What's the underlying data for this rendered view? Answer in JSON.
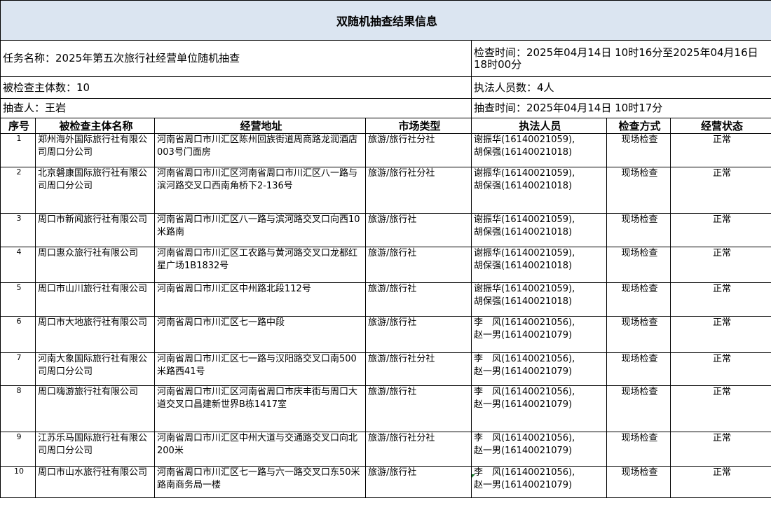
{
  "title": "双随机抽查结果信息",
  "info": {
    "task": "任务名称：2025年第五次旅行社经营单位随机抽查",
    "inspect_time": "检查时间：2025年04月14日 10时16分至2025年04月16日 18时00分",
    "subject_count": "被检查主体数：10",
    "officer_count": "执法人员数：4人",
    "sampler": "抽查人：王岩",
    "sample_time": "抽查时间：2025年04月14日 10时17分"
  },
  "headers": {
    "seq": "序号",
    "name": "被检查主体名称",
    "address": "经营地址",
    "market": "市场类型",
    "officers": "执法人员",
    "method": "检查方式",
    "status": "经营状态"
  },
  "rows": [
    {
      "seq": "1",
      "name": "郑州海外国际旅行社有限公司周口分公司",
      "address": "河南省周口市川汇区陈州回族街道周商路龙润酒店003号门面房",
      "market": "旅游/旅行社分社",
      "officer1": "谢振华(16140021059),",
      "officer2": "胡保强(16140021018)",
      "method": "现场检查",
      "status": "正常"
    },
    {
      "seq": "2",
      "name": "北京磐康国际旅行社有限公司周口分公司",
      "address": "河南省周口市川汇区河南省周口市川汇区八一路与滨河路交叉口西南角桥下2-136号",
      "market": "旅游/旅行社分社",
      "officer1": "谢振华(16140021059),",
      "officer2": "胡保强(16140021018)",
      "method": "现场检查",
      "status": "正常"
    },
    {
      "seq": "3",
      "name": "周口市新闻旅行社有限公司",
      "address": "河南省周口市川汇区八一路与滨河路交叉口向西10米路南",
      "market": "旅游/旅行社",
      "officer1": "谢振华(16140021059),",
      "officer2": "胡保强(16140021018)",
      "method": "现场检查",
      "status": "正常"
    },
    {
      "seq": "4",
      "name": "周口惠众旅行社有限公司",
      "address": "河南省周口市川汇区工农路与黄河路交叉口龙都红星广场1B1832号",
      "market": "旅游/旅行社",
      "officer1": "谢振华(16140021059),",
      "officer2": "胡保强(16140021018)",
      "method": "现场检查",
      "status": "正常"
    },
    {
      "seq": "5",
      "name": "周口市山川旅行社有限公司",
      "address": "河南省周口市川汇区中州路北段112号",
      "market": "旅游/旅行社",
      "officer1": "谢振华(16140021059),",
      "officer2": "胡保强(16140021018)",
      "method": "现场检查",
      "status": "正常"
    },
    {
      "seq": "6",
      "name": "周口市大地旅行社有限公司",
      "address": "河南省周口市川汇区七一路中段",
      "market": "旅游/旅行社",
      "officer1": "李　风(16140021056),",
      "officer2": "赵一男(16140021079)",
      "method": "现场检查",
      "status": "正常"
    },
    {
      "seq": "7",
      "name": "河南大象国际旅行社有限公司周口分公司",
      "address": "河南省周口市川汇区七一路与汉阳路交叉口南500米路西41号",
      "market": "旅游/旅行社分社",
      "officer1": "李　风(16140021056),",
      "officer2": "赵一男(16140021079)",
      "method": "现场检查",
      "status": "正常"
    },
    {
      "seq": "8",
      "name": "周口嗨游旅行社有限公司",
      "address": "河南省周口市川汇区河南省周口市庆丰街与周口大道交叉口昌建新世界B栋1417室",
      "market": "旅游/旅行社",
      "officer1": "李　风(16140021056),",
      "officer2": "赵一男(16140021079)",
      "method": "现场检查",
      "status": "正常"
    },
    {
      "seq": "9",
      "name": "江苏乐马国际旅行社有限公司周口分公司",
      "address": "河南省周口市川汇区中州大道与交通路交叉口向北200米",
      "market": "旅游/旅行社分社",
      "officer1": "李　风(16140021056),",
      "officer2": "赵一男(16140021079)",
      "method": "现场检查",
      "status": "正常"
    },
    {
      "seq": "10",
      "name": "周口市山水旅行社有限公司",
      "address": "河南省周口市川汇区七一路与六一路交叉口东50米路南商务局一楼",
      "market": "旅游/旅行社",
      "officer1": "李　风(16140021056),",
      "officer2": "赵一男(16140021079)",
      "method": "现场检查",
      "status": "正常"
    }
  ]
}
